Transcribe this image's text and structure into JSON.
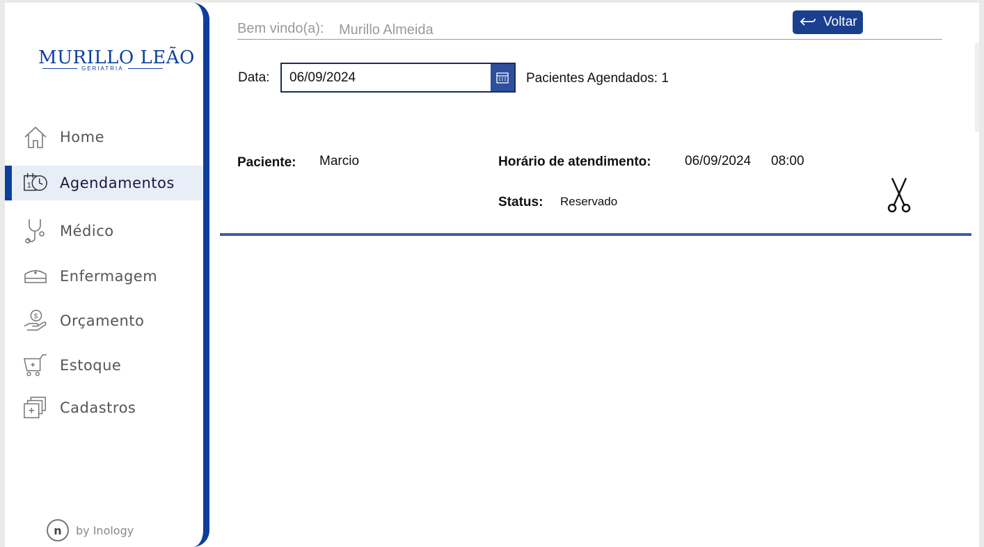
{
  "brand": {
    "name": "MURILLO LEÃO",
    "subtitle": "GERIATRIA",
    "footer": "by Inology",
    "footer_logo": "n"
  },
  "sidebar": {
    "items": [
      {
        "label": "Home",
        "icon": "home-icon",
        "active": false
      },
      {
        "label": "Agendamentos",
        "icon": "calendar-clock-icon",
        "active": true
      },
      {
        "label": "Médico",
        "icon": "stethoscope-icon",
        "active": false
      },
      {
        "label": "Enfermagem",
        "icon": "nurse-cap-icon",
        "active": false
      },
      {
        "label": "Orçamento",
        "icon": "money-hand-icon",
        "active": false
      },
      {
        "label": "Estoque",
        "icon": "medical-cart-icon",
        "active": false
      },
      {
        "label": "Cadastros",
        "icon": "medical-folders-icon",
        "active": false
      }
    ]
  },
  "header": {
    "welcome_label": "Bem vindo(a):",
    "user_name": "Murillo Almeida",
    "back_label": "Voltar"
  },
  "filter": {
    "date_label": "Data:",
    "date_value": "06/09/2024",
    "scheduled_count_label": "Pacientes Agendados: 1"
  },
  "appointment": {
    "patient_label": "Paciente:",
    "patient_value": "Marcio",
    "time_label": "Horário de atendimento:",
    "date_value": "06/09/2024",
    "time_value": "08:00",
    "status_label": "Status:",
    "status_value": "Reservado"
  },
  "colors": {
    "brand_blue": "#0c3f9c",
    "button_blue": "#1b3f8f",
    "separator_blue": "#3a5fa8",
    "active_bg": "#e7eef8"
  }
}
